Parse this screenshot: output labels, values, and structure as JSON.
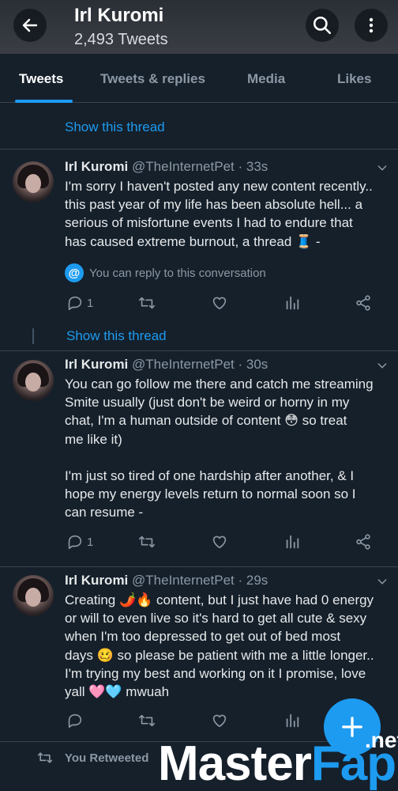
{
  "header": {
    "title": "Irl Kuromi",
    "subtitle": "2,493 Tweets"
  },
  "tabs": [
    {
      "label": "Tweets",
      "active": true
    },
    {
      "label": "Tweets & replies",
      "active": false
    },
    {
      "label": "Media",
      "active": false
    },
    {
      "label": "Likes",
      "active": false
    }
  ],
  "show_thread_label": "Show this thread",
  "tweets": [
    {
      "name": "Irl Kuromi",
      "handle": "@TheInternetPet",
      "time": "· 33s",
      "lines": [
        "I'm sorry I haven't posted any new content recently..",
        "this past year of my life has been absolute hell... a",
        "serious of misfortune events I had to endure that",
        "has caused extreme burnout, a thread 🧵 -"
      ],
      "reply_note": "You can reply to this conversation",
      "reply_count": "1"
    },
    {
      "name": "Irl Kuromi",
      "handle": "@TheInternetPet",
      "time": "· 30s",
      "lines": [
        "You can go follow me there and catch me streaming",
        "Smite usually (just don't be weird or horny in my",
        "chat, I'm a human outside of content 😳 so treat",
        "me like it)",
        "",
        "I'm just so tired of one hardship after another, & I",
        "hope my energy levels return to normal soon so I",
        "can resume -"
      ],
      "reply_count": "1"
    },
    {
      "name": "Irl Kuromi",
      "handle": "@TheInternetPet",
      "time": "· 29s",
      "lines": [
        "Creating 🌶️🔥 content, but I just have had 0 energy",
        "or will to even live so it's hard to get all cute & sexy",
        "when I'm too depressed to get out of bed most",
        "days 🥴 so please be patient with me a little longer..",
        "I'm trying my best and working on it I promise, love",
        "yall 🩷🩵 mwuah"
      ],
      "reply_count": ""
    }
  ],
  "retweet_label": "You Retweeted",
  "watermark": {
    "main": "Master",
    "accent": "Fap",
    "suffix": ".net"
  },
  "colors": {
    "accent": "#1d9bf0",
    "background": "#15202b",
    "muted": "#8b98a5"
  }
}
